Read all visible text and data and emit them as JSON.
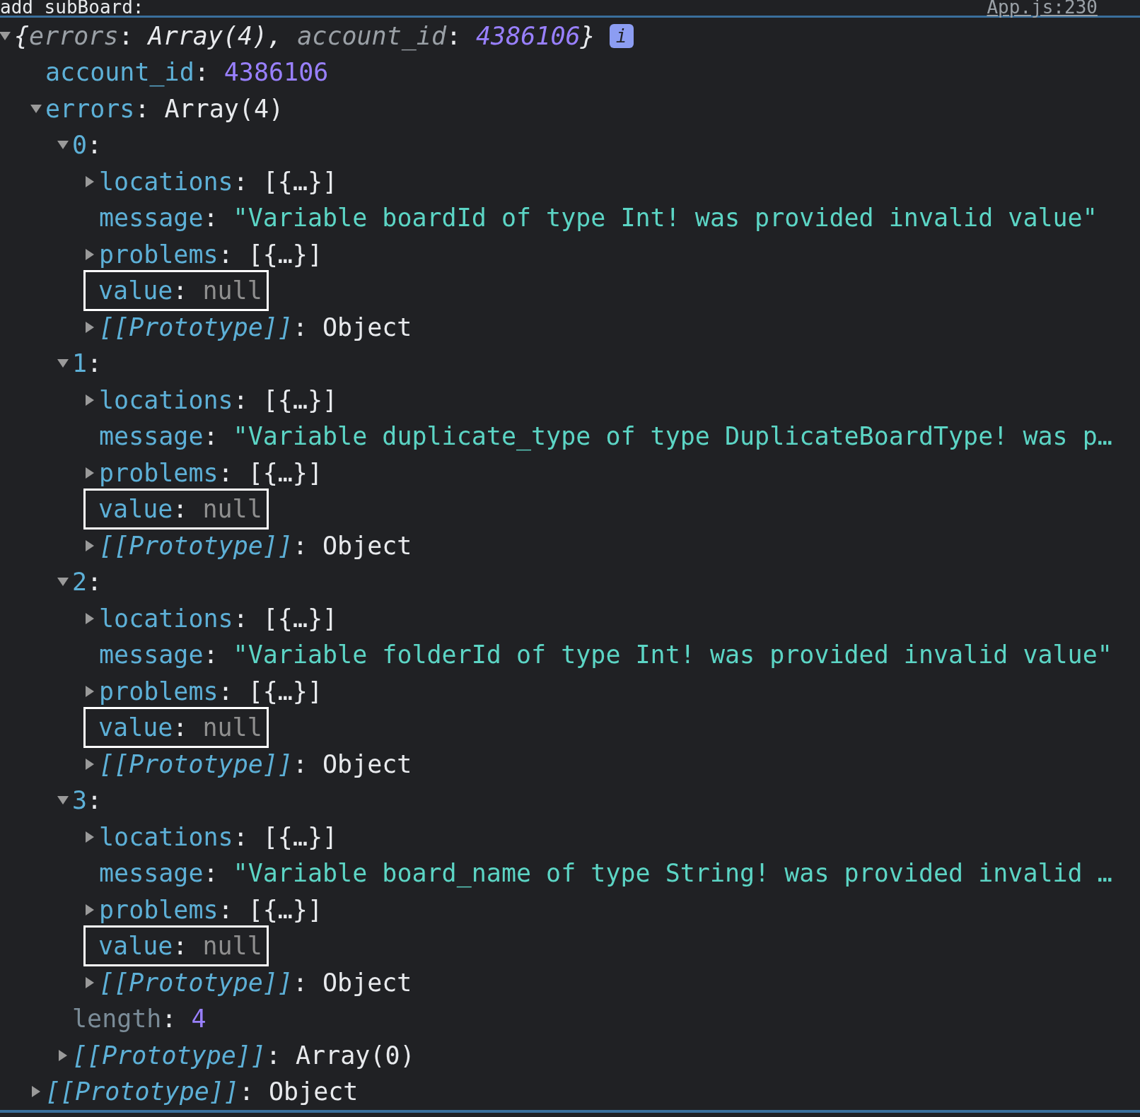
{
  "header": {
    "label": "add subBoard:",
    "source_link": "App.js:230"
  },
  "syntax": {
    "key_separator": ":",
    "preview_open": "{",
    "preview_close": "}",
    "preview_separator": ","
  },
  "root": {
    "expanded": true,
    "preview": [
      {
        "key": "errors",
        "value": "Array(4)",
        "kind": "object"
      },
      {
        "key": "account_id",
        "value": "4386106",
        "kind": "number"
      }
    ],
    "badge": "i",
    "children": [
      {
        "key": "account_id",
        "kind": "number",
        "value": "4386106",
        "highlighted": false
      },
      {
        "key": "errors",
        "kind": "object",
        "value": "Array(4)",
        "expanded": true,
        "highlighted": false,
        "children": [
          {
            "key": "0",
            "kind": "object",
            "expanded": true,
            "highlighted": false,
            "children": [
              {
                "key": "locations",
                "kind": "object",
                "value": "[{…}]",
                "expanded": false,
                "highlighted": false
              },
              {
                "key": "message",
                "kind": "string",
                "value": "\"Variable boardId of type Int! was provided invalid value\"",
                "highlighted": false
              },
              {
                "key": "problems",
                "kind": "object",
                "value": "[{…}]",
                "expanded": false,
                "highlighted": false
              },
              {
                "key": "value",
                "kind": "null",
                "value": "null",
                "highlighted": true
              },
              {
                "key": "[[Prototype]]",
                "kind": "internal",
                "value": "Object",
                "expanded": false,
                "highlighted": false
              }
            ]
          },
          {
            "key": "1",
            "kind": "object",
            "expanded": true,
            "highlighted": false,
            "children": [
              {
                "key": "locations",
                "kind": "object",
                "value": "[{…}]",
                "expanded": false,
                "highlighted": false
              },
              {
                "key": "message",
                "kind": "string",
                "value": "\"Variable duplicate_type of type DuplicateBoardType! was p…",
                "highlighted": false
              },
              {
                "key": "problems",
                "kind": "object",
                "value": "[{…}]",
                "expanded": false,
                "highlighted": false
              },
              {
                "key": "value",
                "kind": "null",
                "value": "null",
                "highlighted": true
              },
              {
                "key": "[[Prototype]]",
                "kind": "internal",
                "value": "Object",
                "expanded": false,
                "highlighted": false
              }
            ]
          },
          {
            "key": "2",
            "kind": "object",
            "expanded": true,
            "highlighted": false,
            "children": [
              {
                "key": "locations",
                "kind": "object",
                "value": "[{…}]",
                "expanded": false,
                "highlighted": false
              },
              {
                "key": "message",
                "kind": "string",
                "value": "\"Variable folderId of type Int! was provided invalid value\"",
                "highlighted": false
              },
              {
                "key": "problems",
                "kind": "object",
                "value": "[{…}]",
                "expanded": false,
                "highlighted": false
              },
              {
                "key": "value",
                "kind": "null",
                "value": "null",
                "highlighted": true
              },
              {
                "key": "[[Prototype]]",
                "kind": "internal",
                "value": "Object",
                "expanded": false,
                "highlighted": false
              }
            ]
          },
          {
            "key": "3",
            "kind": "object",
            "expanded": true,
            "highlighted": false,
            "children": [
              {
                "key": "locations",
                "kind": "object",
                "value": "[{…}]",
                "expanded": false,
                "highlighted": false
              },
              {
                "key": "message",
                "kind": "string",
                "value": "\"Variable board_name of type String! was provided invalid …",
                "highlighted": false
              },
              {
                "key": "problems",
                "kind": "object",
                "value": "[{…}]",
                "expanded": false,
                "highlighted": false
              },
              {
                "key": "value",
                "kind": "null",
                "value": "null",
                "highlighted": true
              },
              {
                "key": "[[Prototype]]",
                "kind": "internal",
                "value": "Object",
                "expanded": false,
                "highlighted": false
              }
            ]
          },
          {
            "key": "length",
            "kind": "hidden",
            "value": "4",
            "highlighted": false
          },
          {
            "key": "[[Prototype]]",
            "kind": "internal",
            "value": "Array(0)",
            "expanded": false,
            "highlighted": false
          }
        ]
      },
      {
        "key": "[[Prototype]]",
        "kind": "internal",
        "value": "Object",
        "expanded": false,
        "highlighted": false
      }
    ]
  }
}
